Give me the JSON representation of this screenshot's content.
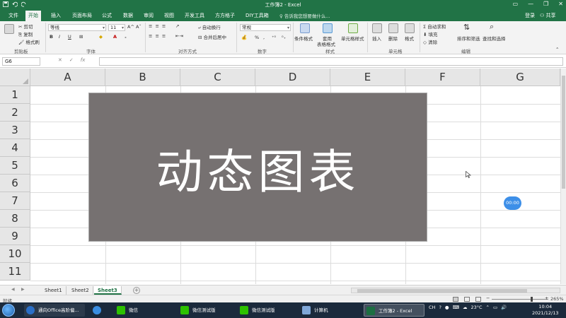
{
  "window": {
    "title": "工作簿2 - Excel"
  },
  "tabs": [
    "文件",
    "开始",
    "插入",
    "页面布局",
    "公式",
    "数据",
    "审阅",
    "视图",
    "开发工具",
    "方方格子",
    "DIY工具箱"
  ],
  "tell_me": "告诉我您想要做什么...",
  "account": {
    "login": "登录",
    "share": "共享"
  },
  "ribbon": {
    "clipboard": {
      "cut": "剪切",
      "copy": "复制",
      "format_painter": "格式刷",
      "label": "剪贴板"
    },
    "font": {
      "name": "等线",
      "size": "11",
      "bold": "B",
      "italic": "I",
      "underline": "U",
      "label": "字体"
    },
    "alignment": {
      "wrap": "自动换行",
      "merge": "合并后居中",
      "label": "对齐方式"
    },
    "number": {
      "format": "常规",
      "percent": "%",
      "label": "数字"
    },
    "styles": {
      "conditional": "条件格式",
      "table_line1": "套用",
      "table_line2": "表格格式",
      "cell_styles": "单元格样式",
      "label": "样式"
    },
    "cells": {
      "insert": "插入",
      "delete": "删除",
      "format": "格式",
      "label": "单元格"
    },
    "editing": {
      "autosum": "自动求和",
      "fill": "填充",
      "clear": "清除",
      "sort": "排序和筛选",
      "find": "查找和选择",
      "label": "编辑"
    }
  },
  "formula_bar": {
    "name_box": "G6",
    "fx": "fx"
  },
  "columns": [
    "A",
    "B",
    "C",
    "D",
    "E",
    "F",
    "G"
  ],
  "rows": [
    "1",
    "2",
    "3",
    "4",
    "5",
    "6",
    "7",
    "8",
    "9",
    "10",
    "11"
  ],
  "chart_box": {
    "text": "动态图表"
  },
  "timer_badge": "00:00",
  "sheets": [
    {
      "name": "Sheet1",
      "active": false
    },
    {
      "name": "Sheet2",
      "active": false
    },
    {
      "name": "Sheet3",
      "active": true
    }
  ],
  "status": {
    "ready": "就绪",
    "zoom": "265%"
  },
  "taskbar": {
    "items": [
      "通向Office高阶偏...",
      "",
      "微信",
      "微信测试版",
      "微信测试版",
      "计算机",
      "工作簿2 - Excel"
    ],
    "tray": {
      "lang": "CH",
      "temp": "23°C"
    },
    "clock": {
      "time": "10:04",
      "date": "2021/12/13"
    }
  },
  "colors": {
    "excel_green": "#217346",
    "chart_fill": "#767171",
    "taskbar": "#1b2a3c",
    "badge": "#3d8fe8"
  }
}
